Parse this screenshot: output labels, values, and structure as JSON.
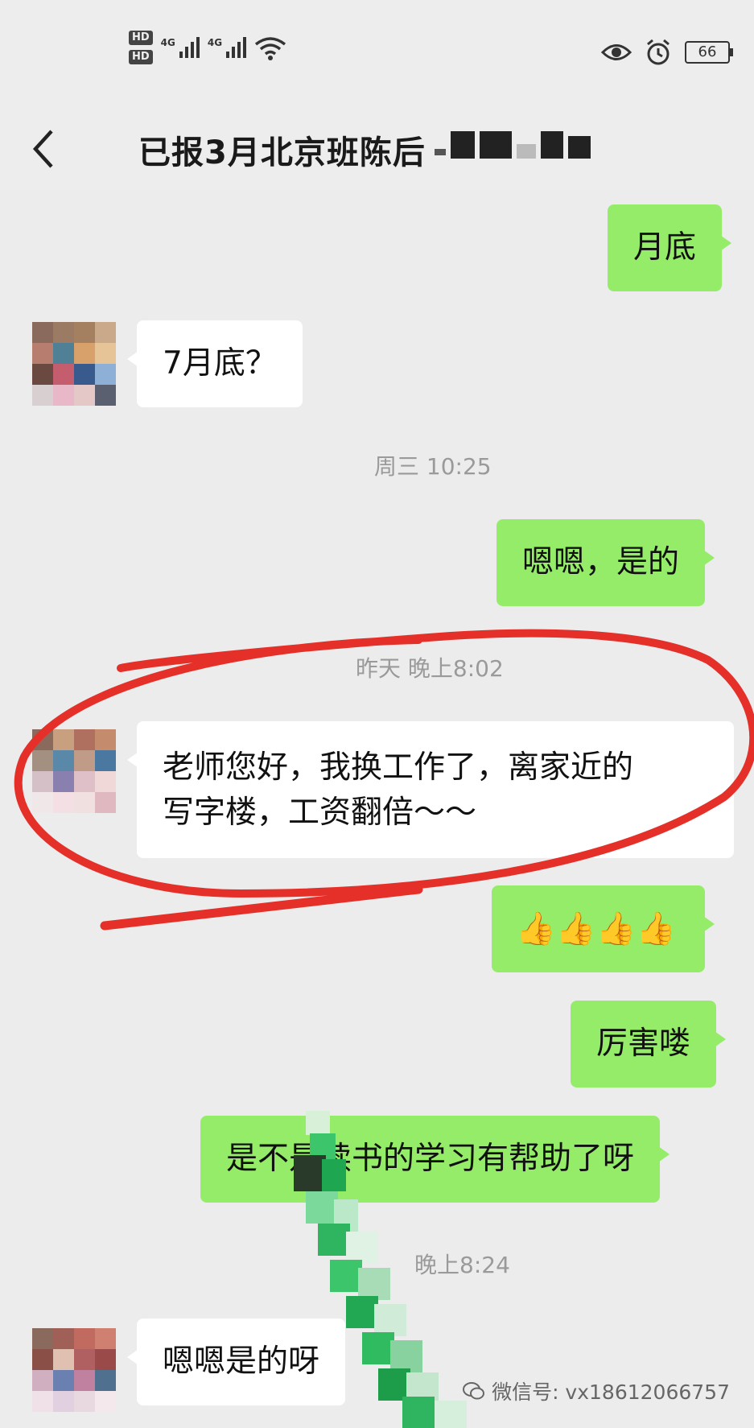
{
  "statusbar": {
    "hd1": "HD",
    "hd2": "HD",
    "net1": "4G",
    "net2": "4G",
    "battery": "66"
  },
  "header": {
    "title": "已报3月北京班陈后"
  },
  "messages": [
    {
      "from": "me",
      "text": "月底"
    },
    {
      "from": "them",
      "text": "7月底？"
    },
    {
      "type": "time",
      "text": "周三 10:25"
    },
    {
      "from": "me",
      "text": "嗯嗯，是的"
    },
    {
      "type": "time",
      "text": "昨天 晚上8:02"
    },
    {
      "from": "them",
      "lines": [
        "老师您好，我换工作了，离家近的",
        "写字楼，工资翻倍～～"
      ]
    },
    {
      "from": "me",
      "text": "👍👍👍👍"
    },
    {
      "from": "me",
      "text": "厉害喽"
    },
    {
      "from": "me",
      "text": "是不是读书的学习有帮助了呀"
    },
    {
      "type": "time",
      "text": "晚上8:24"
    },
    {
      "from": "them",
      "text": "嗯嗯是的呀"
    }
  ],
  "watermark": {
    "text": "微信号: vx18612066757"
  },
  "colors": {
    "me_bubble": "#95ec69",
    "them_bubble": "#ffffff",
    "annotation": "#e5302a"
  }
}
